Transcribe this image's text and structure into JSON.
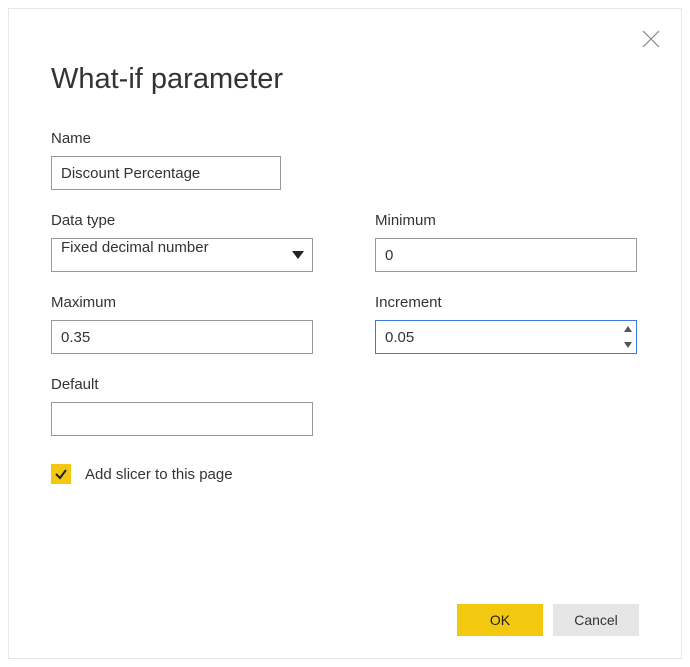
{
  "dialog": {
    "title": "What-if parameter"
  },
  "fields": {
    "name": {
      "label": "Name",
      "value": "Discount Percentage"
    },
    "datatype": {
      "label": "Data type",
      "value": "Fixed decimal number"
    },
    "minimum": {
      "label": "Minimum",
      "value": "0"
    },
    "maximum": {
      "label": "Maximum",
      "value": "0.35"
    },
    "increment": {
      "label": "Increment",
      "value": "0.05"
    },
    "default": {
      "label": "Default",
      "value": ""
    }
  },
  "checkbox": {
    "label": "Add slicer to this page",
    "checked": true
  },
  "buttons": {
    "ok": "OK",
    "cancel": "Cancel"
  },
  "colors": {
    "accent": "#F2C811"
  }
}
